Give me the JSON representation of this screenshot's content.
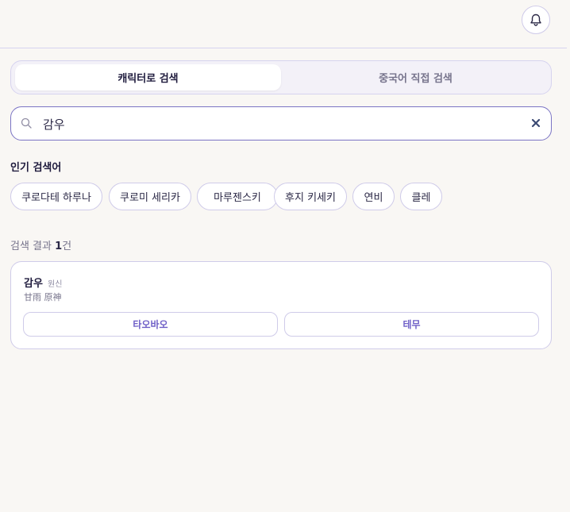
{
  "header": {
    "bell_icon": "bell-icon"
  },
  "tabs": [
    {
      "label": "캐릭터로 검색",
      "active": true
    },
    {
      "label": "중국어 직접 검색",
      "active": false
    }
  ],
  "search": {
    "value": "감우",
    "placeholder": "",
    "search_icon": "search-icon",
    "clear_icon": "close-icon"
  },
  "popular": {
    "title": "인기 검색어",
    "chips": [
      "쿠로다테 하루나",
      "쿠로미 세리카",
      "마루젠스키",
      "후지 키세키",
      "연비",
      "클레"
    ]
  },
  "results": {
    "prefix": "검색 결과 ",
    "count": "1",
    "suffix": "건",
    "items": [
      {
        "name": "감우",
        "game": "원신",
        "chinese": "甘雨 原神",
        "platforms": [
          "타오바오",
          "테무"
        ]
      }
    ]
  },
  "colors": {
    "accent": "#6e5fc7",
    "border": "#cfcbe9",
    "background": "#f9f7f4",
    "search_border": "#7b74c4"
  }
}
